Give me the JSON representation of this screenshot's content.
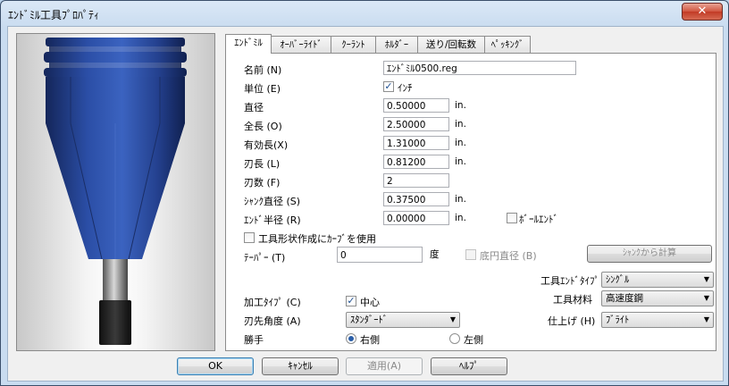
{
  "window": {
    "title": "ｴﾝﾄﾞﾐﾙ工具ﾌﾟﾛﾊﾟﾃｨ",
    "close_glyph": "✕"
  },
  "tabs": [
    "ｴﾝﾄﾞﾐﾙ",
    "ｵｰﾊﾞｰﾗｲﾄﾞ",
    "ｸｰﾗﾝﾄ",
    "ﾎﾙﾀﾞｰ",
    "送り/回転数",
    "ﾍﾟｯｷﾝｸﾞ"
  ],
  "form": {
    "name": {
      "label": "名前 (N)",
      "value": "ｴﾝﾄﾞﾐﾙ0500.reg"
    },
    "unit": {
      "label": "単位 (E)",
      "checkbox_label": "ｲﾝﾁ",
      "checked": true
    },
    "diameter": {
      "label": "直径",
      "value": "0.50000",
      "unit": "in."
    },
    "overall_length": {
      "label": "全長 (O)",
      "value": "2.50000",
      "unit": "in."
    },
    "effective_length": {
      "label": "有効長(X)",
      "value": "1.31000",
      "unit": "in."
    },
    "flute_length": {
      "label": "刃長 (L)",
      "value": "0.81200",
      "unit": "in."
    },
    "flutes": {
      "label": "刃数 (F)",
      "value": "2"
    },
    "shank_diameter": {
      "label": "ｼｬﾝｸ直径 (S)",
      "value": "0.37500",
      "unit": "in."
    },
    "end_radius": {
      "label": "ｴﾝﾄﾞ半径 (R)",
      "value": "0.00000",
      "unit": "in."
    },
    "ball_end": {
      "label": "ﾎﾞｰﾙｴﾝﾄﾞ",
      "checked": false
    },
    "use_curve": {
      "label": "工具形状作成にｶｰﾌﾞを使用",
      "checked": false
    },
    "taper": {
      "label": "ﾃｰﾊﾟｰ (T)",
      "value": "0",
      "unit": "度"
    },
    "bottom_diameter": {
      "label": "底円直径 (B)",
      "checked": false
    },
    "calc_from_shank": "ｼｬﾝｸから計算",
    "end_type": {
      "label": "工具ｴﾝﾄﾞﾀｲﾌﾟ (Y)",
      "value": "ｼﾝｸﾞﾙ"
    },
    "machining_type": {
      "label": "加工ﾀｲﾌﾟ (C)",
      "checkbox_label": "中心",
      "checked": true
    },
    "material": {
      "label": "工具材料",
      "value": "高速度鋼"
    },
    "point_angle": {
      "label": "刃先角度 (A)",
      "value": "ｽﾀﾝﾀﾞｰﾄﾞ"
    },
    "finish": {
      "label": "仕上げ (H)",
      "value": "ﾌﾞﾗｲﾄ"
    },
    "hand": {
      "label": "勝手",
      "right": "右側",
      "left": "左側",
      "selected": "right"
    }
  },
  "buttons": {
    "ok": "OK",
    "cancel": "ｷｬﾝｾﾙ",
    "apply": "適用(A)",
    "help": "ﾍﾙﾌﾟ"
  },
  "colors": {
    "tool_blue": "#2a4a9c",
    "title_bg": "#c9dcf0"
  }
}
